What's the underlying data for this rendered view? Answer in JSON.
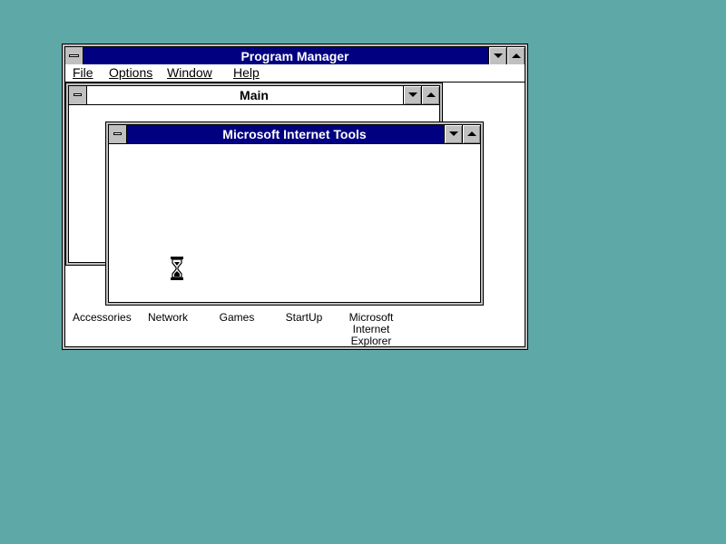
{
  "desktop": {
    "background_color": "#5ea8a8"
  },
  "program_manager": {
    "title": "Program Manager",
    "menu": [
      {
        "label": "File"
      },
      {
        "label": "Options"
      },
      {
        "label": "Window"
      },
      {
        "label": "Help"
      }
    ],
    "group_icons": [
      {
        "label": "Accessories"
      },
      {
        "label": "Network"
      },
      {
        "label": "Games"
      },
      {
        "label": "StartUp"
      },
      {
        "label": "Microsoft Internet Explorer"
      }
    ]
  },
  "main_group": {
    "title": "Main"
  },
  "internet_tools": {
    "title": "Microsoft Internet Tools"
  },
  "cursor": {
    "icon": "hourglass-icon"
  },
  "colors": {
    "active_title": "#000080",
    "chrome": "#c0c0c0"
  }
}
